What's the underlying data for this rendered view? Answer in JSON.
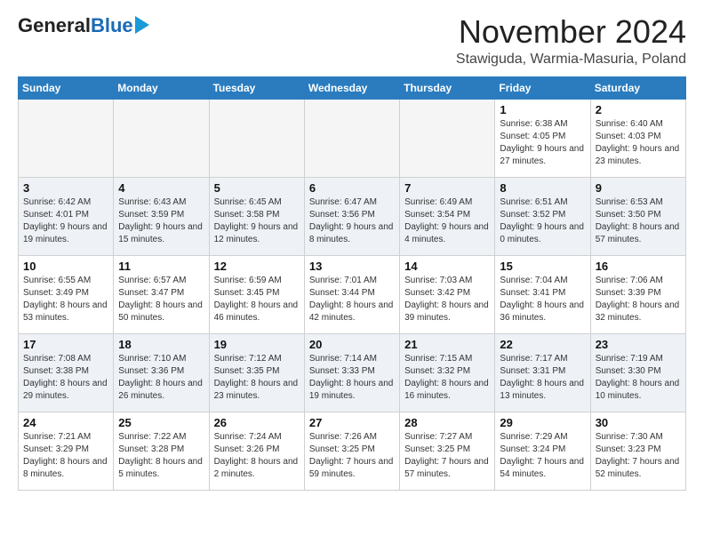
{
  "logo": {
    "general": "General",
    "blue": "Blue"
  },
  "title": "November 2024",
  "subtitle": "Stawiguda, Warmia-Masuria, Poland",
  "days_of_week": [
    "Sunday",
    "Monday",
    "Tuesday",
    "Wednesday",
    "Thursday",
    "Friday",
    "Saturday"
  ],
  "weeks": [
    [
      {
        "day": null,
        "info": null
      },
      {
        "day": null,
        "info": null
      },
      {
        "day": null,
        "info": null
      },
      {
        "day": null,
        "info": null
      },
      {
        "day": null,
        "info": null
      },
      {
        "day": "1",
        "info": "Sunrise: 6:38 AM\nSunset: 4:05 PM\nDaylight: 9 hours and 27 minutes."
      },
      {
        "day": "2",
        "info": "Sunrise: 6:40 AM\nSunset: 4:03 PM\nDaylight: 9 hours and 23 minutes."
      }
    ],
    [
      {
        "day": "3",
        "info": "Sunrise: 6:42 AM\nSunset: 4:01 PM\nDaylight: 9 hours and 19 minutes."
      },
      {
        "day": "4",
        "info": "Sunrise: 6:43 AM\nSunset: 3:59 PM\nDaylight: 9 hours and 15 minutes."
      },
      {
        "day": "5",
        "info": "Sunrise: 6:45 AM\nSunset: 3:58 PM\nDaylight: 9 hours and 12 minutes."
      },
      {
        "day": "6",
        "info": "Sunrise: 6:47 AM\nSunset: 3:56 PM\nDaylight: 9 hours and 8 minutes."
      },
      {
        "day": "7",
        "info": "Sunrise: 6:49 AM\nSunset: 3:54 PM\nDaylight: 9 hours and 4 minutes."
      },
      {
        "day": "8",
        "info": "Sunrise: 6:51 AM\nSunset: 3:52 PM\nDaylight: 9 hours and 0 minutes."
      },
      {
        "day": "9",
        "info": "Sunrise: 6:53 AM\nSunset: 3:50 PM\nDaylight: 8 hours and 57 minutes."
      }
    ],
    [
      {
        "day": "10",
        "info": "Sunrise: 6:55 AM\nSunset: 3:49 PM\nDaylight: 8 hours and 53 minutes."
      },
      {
        "day": "11",
        "info": "Sunrise: 6:57 AM\nSunset: 3:47 PM\nDaylight: 8 hours and 50 minutes."
      },
      {
        "day": "12",
        "info": "Sunrise: 6:59 AM\nSunset: 3:45 PM\nDaylight: 8 hours and 46 minutes."
      },
      {
        "day": "13",
        "info": "Sunrise: 7:01 AM\nSunset: 3:44 PM\nDaylight: 8 hours and 42 minutes."
      },
      {
        "day": "14",
        "info": "Sunrise: 7:03 AM\nSunset: 3:42 PM\nDaylight: 8 hours and 39 minutes."
      },
      {
        "day": "15",
        "info": "Sunrise: 7:04 AM\nSunset: 3:41 PM\nDaylight: 8 hours and 36 minutes."
      },
      {
        "day": "16",
        "info": "Sunrise: 7:06 AM\nSunset: 3:39 PM\nDaylight: 8 hours and 32 minutes."
      }
    ],
    [
      {
        "day": "17",
        "info": "Sunrise: 7:08 AM\nSunset: 3:38 PM\nDaylight: 8 hours and 29 minutes."
      },
      {
        "day": "18",
        "info": "Sunrise: 7:10 AM\nSunset: 3:36 PM\nDaylight: 8 hours and 26 minutes."
      },
      {
        "day": "19",
        "info": "Sunrise: 7:12 AM\nSunset: 3:35 PM\nDaylight: 8 hours and 23 minutes."
      },
      {
        "day": "20",
        "info": "Sunrise: 7:14 AM\nSunset: 3:33 PM\nDaylight: 8 hours and 19 minutes."
      },
      {
        "day": "21",
        "info": "Sunrise: 7:15 AM\nSunset: 3:32 PM\nDaylight: 8 hours and 16 minutes."
      },
      {
        "day": "22",
        "info": "Sunrise: 7:17 AM\nSunset: 3:31 PM\nDaylight: 8 hours and 13 minutes."
      },
      {
        "day": "23",
        "info": "Sunrise: 7:19 AM\nSunset: 3:30 PM\nDaylight: 8 hours and 10 minutes."
      }
    ],
    [
      {
        "day": "24",
        "info": "Sunrise: 7:21 AM\nSunset: 3:29 PM\nDaylight: 8 hours and 8 minutes."
      },
      {
        "day": "25",
        "info": "Sunrise: 7:22 AM\nSunset: 3:28 PM\nDaylight: 8 hours and 5 minutes."
      },
      {
        "day": "26",
        "info": "Sunrise: 7:24 AM\nSunset: 3:26 PM\nDaylight: 8 hours and 2 minutes."
      },
      {
        "day": "27",
        "info": "Sunrise: 7:26 AM\nSunset: 3:25 PM\nDaylight: 7 hours and 59 minutes."
      },
      {
        "day": "28",
        "info": "Sunrise: 7:27 AM\nSunset: 3:25 PM\nDaylight: 7 hours and 57 minutes."
      },
      {
        "day": "29",
        "info": "Sunrise: 7:29 AM\nSunset: 3:24 PM\nDaylight: 7 hours and 54 minutes."
      },
      {
        "day": "30",
        "info": "Sunrise: 7:30 AM\nSunset: 3:23 PM\nDaylight: 7 hours and 52 minutes."
      }
    ]
  ]
}
